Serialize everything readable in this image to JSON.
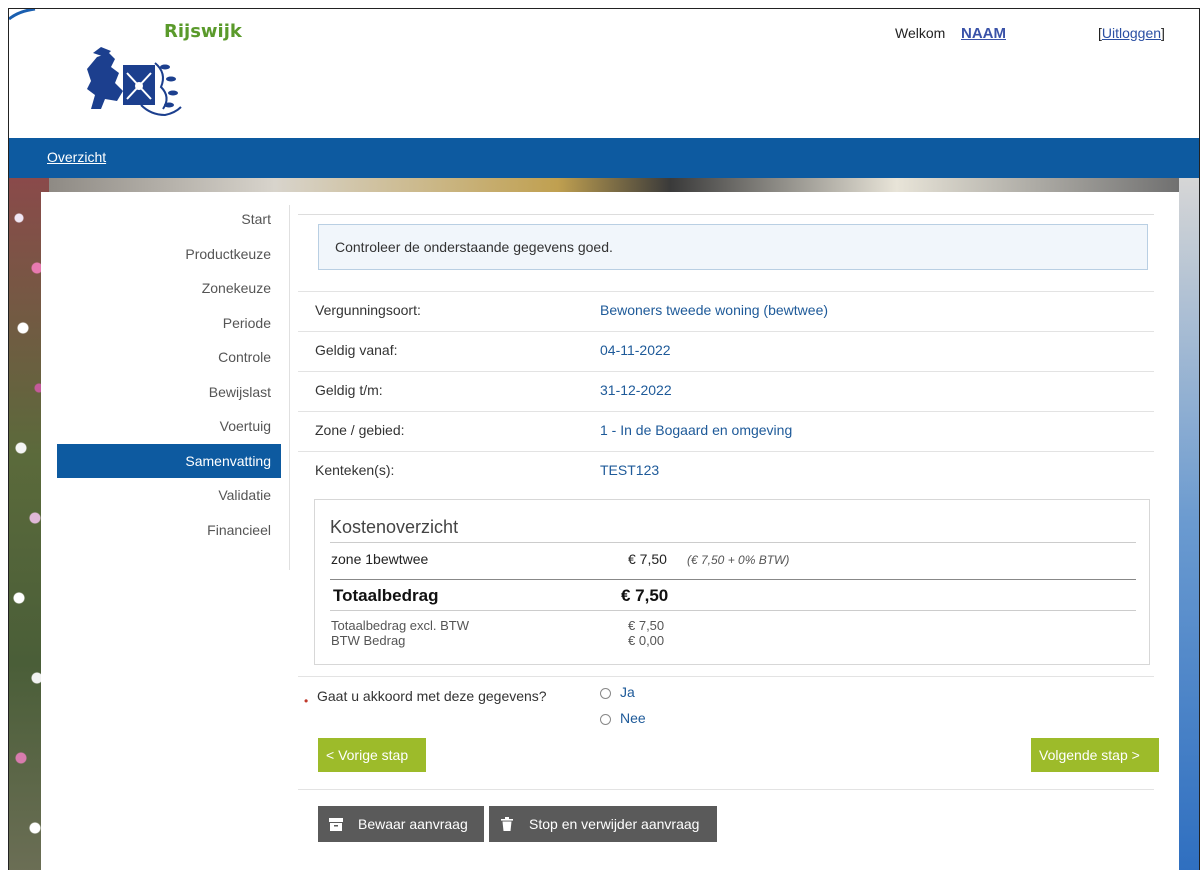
{
  "header": {
    "brand": "Rijswijk",
    "welcome_label": "Welkom",
    "user_name": "NAAM",
    "logout_label": "Uitloggen",
    "logout_open_bracket": "[",
    "logout_close_bracket": "]"
  },
  "nav": {
    "overview_link": "Overzicht"
  },
  "side_menu": {
    "items": [
      {
        "label": "Start"
      },
      {
        "label": "Productkeuze"
      },
      {
        "label": "Zonekeuze"
      },
      {
        "label": "Periode"
      },
      {
        "label": "Controle"
      },
      {
        "label": "Bewijslast"
      },
      {
        "label": "Voertuig"
      },
      {
        "label": "Samenvatting"
      },
      {
        "label": "Validatie"
      },
      {
        "label": "Financieel"
      }
    ],
    "active": "Samenvatting"
  },
  "main": {
    "info_message": "Controleer de onderstaande gegevens goed.",
    "details": [
      {
        "label": "Vergunningsoort:",
        "value": "Bewoners tweede woning (bewtwee)"
      },
      {
        "label": "Geldig vanaf:",
        "value": "04-11-2022"
      },
      {
        "label": "Geldig t/m:",
        "value": "31-12-2022"
      },
      {
        "label": "Zone / gebied:",
        "value": "1 - In de Bogaard en omgeving"
      },
      {
        "label": "Kenteken(s):",
        "value": "TEST123"
      }
    ],
    "costs": {
      "title": "Kostenoverzicht",
      "line_item": {
        "name": "zone 1bewtwee",
        "amount": "€ 7,50",
        "note": "(€ 7,50 + 0% BTW)"
      },
      "total_label": "Totaalbedrag",
      "total_amount": "€ 7,50",
      "excl_label": "Totaalbedrag excl. BTW",
      "excl_amount": "€ 7,50",
      "btw_label": "BTW Bedrag",
      "btw_amount": "€ 0,00"
    },
    "question": {
      "required_marker": "•",
      "text": "Gaat u akkoord met deze gegevens?",
      "options": [
        "Ja",
        "Nee"
      ]
    },
    "buttons": {
      "prev": "< Vorige stap",
      "next": "Volgende stap >",
      "save": "Bewaar aanvraag",
      "stop": "Stop en verwijder aanvraag"
    }
  },
  "colors": {
    "brand_blue": "#0d5aa0",
    "brand_green": "#9dbb2a",
    "link_blue": "#1e5a99",
    "logo_green": "#5a9a2b",
    "dark_button": "#5a5a5a"
  }
}
